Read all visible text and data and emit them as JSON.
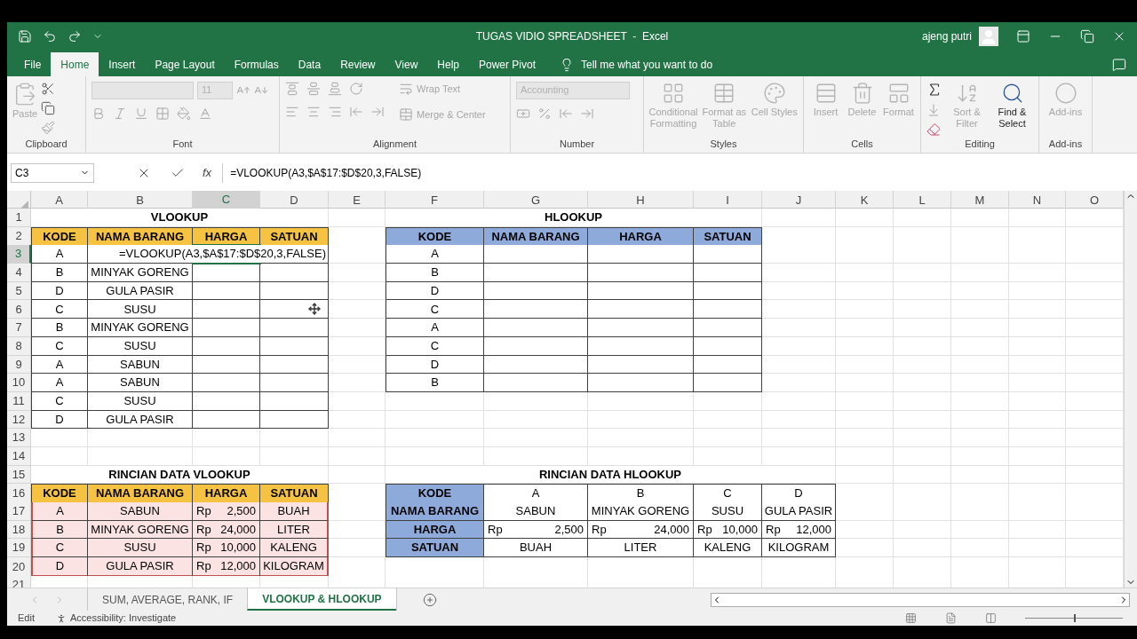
{
  "window": {
    "title": "TUGAS VIDIO SPREADSHEET  -  Excel",
    "user": "ajeng putri"
  },
  "ribbon_tabs": [
    {
      "label": "File",
      "selected": false
    },
    {
      "label": "Home",
      "selected": true
    },
    {
      "label": "Insert",
      "selected": false
    },
    {
      "label": "Page Layout",
      "selected": false
    },
    {
      "label": "Formulas",
      "selected": false
    },
    {
      "label": "Data",
      "selected": false
    },
    {
      "label": "Review",
      "selected": false
    },
    {
      "label": "View",
      "selected": false
    },
    {
      "label": "Help",
      "selected": false
    },
    {
      "label": "Power Pivot",
      "selected": false
    }
  ],
  "tell_me": {
    "placeholder": "Tell me what you want to do"
  },
  "ribbon": {
    "clipboard": {
      "label": "Clipboard",
      "paste": {
        "label": "Paste",
        "disabled": true
      }
    },
    "font": {
      "label": "Font",
      "size": "11"
    },
    "alignment": {
      "label": "Alignment",
      "buttons": [
        {
          "label": "Wrap Text",
          "disabled": true
        },
        {
          "label": "Merge & Center",
          "disabled": true
        }
      ]
    },
    "number": {
      "label": "Number",
      "format": "Accounting"
    },
    "styles": {
      "label": "Styles",
      "buttons": [
        {
          "label": "Conditional Formatting",
          "disabled": true
        },
        {
          "label": "Format as Table",
          "disabled": true
        },
        {
          "label": "Cell Styles",
          "disabled": true
        }
      ]
    },
    "cells": {
      "label": "Cells",
      "buttons": [
        {
          "label": "Insert",
          "disabled": true
        },
        {
          "label": "Delete",
          "disabled": true
        },
        {
          "label": "Format",
          "disabled": true
        }
      ]
    },
    "editing": {
      "label": "Editing",
      "buttons": [
        {
          "label": "Sort & Filter",
          "disabled": true
        },
        {
          "label": "Find & Select",
          "disabled": false
        }
      ]
    },
    "addins": {
      "label": "Add-ins",
      "buttons": [
        {
          "label": "Add-ins",
          "disabled": true
        }
      ]
    }
  },
  "formula_bar": {
    "name_box": "C3",
    "function_label": "fx",
    "formula": "=VLOOKUP(A3,$A$17:$D$20,3,FALSE)"
  },
  "sheet": {
    "columns": [
      {
        "label": "A",
        "selected": false
      },
      {
        "label": "B",
        "selected": false
      },
      {
        "label": "C",
        "selected": true
      },
      {
        "label": "D",
        "selected": false
      },
      {
        "label": "E",
        "selected": false
      },
      {
        "label": "F",
        "selected": false
      },
      {
        "label": "G",
        "selected": false
      },
      {
        "label": "H",
        "selected": false
      },
      {
        "label": "I",
        "selected": false
      },
      {
        "label": "J",
        "selected": false
      },
      {
        "label": "K",
        "selected": false
      },
      {
        "label": "L",
        "selected": false
      },
      {
        "label": "M",
        "selected": false
      },
      {
        "label": "N",
        "selected": false
      },
      {
        "label": "O",
        "selected": false
      }
    ],
    "rows": [
      {
        "label": "1",
        "selected": false
      },
      {
        "label": "2",
        "selected": false
      },
      {
        "label": "3",
        "selected": true
      },
      {
        "label": "4",
        "selected": false
      },
      {
        "label": "5",
        "selected": false
      },
      {
        "label": "6",
        "selected": false
      },
      {
        "label": "7",
        "selected": false
      },
      {
        "label": "8",
        "selected": false
      },
      {
        "label": "9",
        "selected": false
      },
      {
        "label": "10",
        "selected": false
      },
      {
        "label": "11",
        "selected": false
      },
      {
        "label": "12",
        "selected": false
      },
      {
        "label": "13",
        "selected": false
      },
      {
        "label": "14",
        "selected": false
      },
      {
        "label": "15",
        "selected": false
      },
      {
        "label": "16",
        "selected": false
      },
      {
        "label": "17",
        "selected": false
      },
      {
        "label": "18",
        "selected": false
      },
      {
        "label": "19",
        "selected": false
      },
      {
        "label": "20",
        "selected": false
      },
      {
        "label": "21",
        "selected": false
      }
    ],
    "editing_cell": {
      "text": "=VLOOKUP(A3,$A$17:$D$20,3,FALSE)"
    },
    "vlookup": {
      "title": "VLOOKUP",
      "headers": [
        "KODE",
        "NAMA BARANG",
        "HARGA",
        "SATUAN"
      ],
      "rows": [
        {
          "kode": "A"
        },
        {
          "kode": "B",
          "nama_barang": "MINYAK GORENG"
        },
        {
          "kode": "D",
          "nama_barang": "GULA PASIR"
        },
        {
          "kode": "C",
          "nama_barang": "SUSU"
        },
        {
          "kode": "B",
          "nama_barang": "MINYAK GORENG"
        },
        {
          "kode": "C",
          "nama_barang": "SUSU"
        },
        {
          "kode": "A",
          "nama_barang": "SABUN"
        },
        {
          "kode": "A",
          "nama_barang": "SABUN"
        },
        {
          "kode": "C",
          "nama_barang": "SUSU"
        },
        {
          "kode": "D",
          "nama_barang": "GULA PASIR"
        }
      ]
    },
    "hlookup": {
      "title": "HLOOKUP",
      "headers": [
        "KODE",
        "NAMA BARANG",
        "HARGA",
        "SATUAN"
      ],
      "rows": [
        {
          "kode": "A"
        },
        {
          "kode": "B"
        },
        {
          "kode": "D"
        },
        {
          "kode": "C"
        },
        {
          "kode": "A"
        },
        {
          "kode": "C"
        },
        {
          "kode": "D"
        },
        {
          "kode": "B"
        }
      ]
    },
    "rincian_vlookup": {
      "title": "RINCIAN DATA VLOOKUP",
      "headers": [
        "KODE",
        "NAMA BARANG",
        "HARGA",
        "SATUAN"
      ],
      "rows": [
        {
          "kode": "A",
          "nama_barang": "SABUN",
          "currency": "Rp",
          "harga": "2,500",
          "satuan": "BUAH"
        },
        {
          "kode": "B",
          "nama_barang": "MINYAK GORENG",
          "currency": "Rp",
          "harga": "24,000",
          "satuan": "LITER"
        },
        {
          "kode": "C",
          "nama_barang": "SUSU",
          "currency": "Rp",
          "harga": "10,000",
          "satuan": "KALENG"
        },
        {
          "kode": "D",
          "nama_barang": "GULA PASIR",
          "currency": "Rp",
          "harga": "12,000",
          "satuan": "KILOGRAM"
        }
      ]
    },
    "rincian_hlookup": {
      "title": "RINCIAN DATA HLOOKUP",
      "row_labels": [
        "KODE",
        "NAMA BARANG",
        "HARGA",
        "SATUAN"
      ],
      "columns": [
        {
          "kode": "A",
          "nama_barang": "SABUN",
          "currency": "Rp",
          "harga": "2,500",
          "satuan": "BUAH"
        },
        {
          "kode": "B",
          "nama_barang": "MINYAK GORENG",
          "currency": "Rp",
          "harga": "24,000",
          "satuan": "LITER"
        },
        {
          "kode": "C",
          "nama_barang": "SUSU",
          "currency": "Rp",
          "harga": "10,000",
          "satuan": "KALENG"
        },
        {
          "kode": "D",
          "nama_barang": "GULA PASIR",
          "currency": "Rp",
          "harga": "12,000",
          "satuan": "KILOGRAM"
        }
      ]
    }
  },
  "sheet_tabs": [
    {
      "label": "SUM, AVERAGE, RANK, IF",
      "selected": false
    },
    {
      "label": "VLOOKUP & HLOOKUP",
      "selected": true
    }
  ],
  "status_bar": {
    "mode": "Edit",
    "accessibility": "Accessibility: Investigate",
    "zoom": {
      "level": 0.5
    }
  }
}
